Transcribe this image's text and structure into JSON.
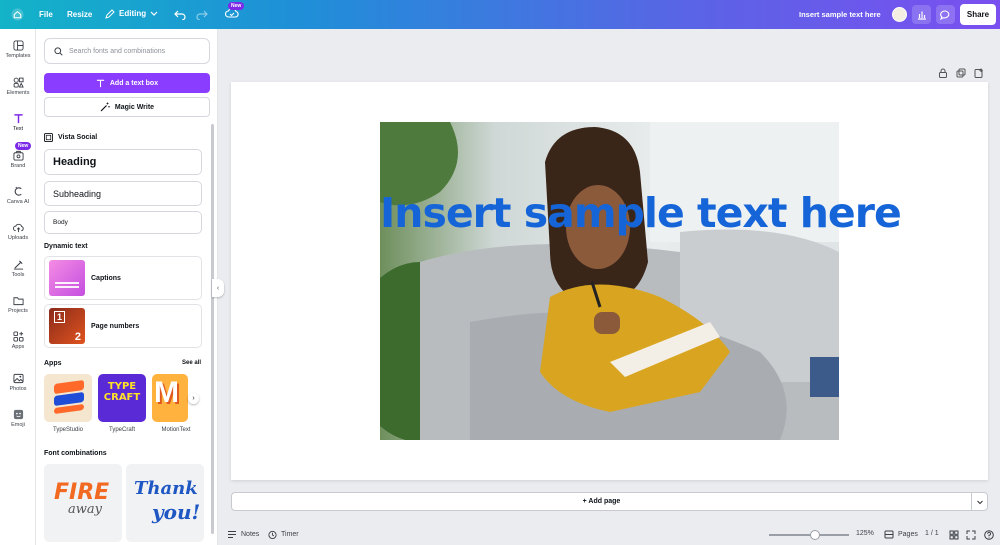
{
  "topbar": {
    "file": "File",
    "resize": "Resize",
    "editing": "Editing",
    "new_badge": "New",
    "doc_title": "Insert sample text here",
    "share": "Share"
  },
  "rail": {
    "items": [
      {
        "label": "Templates",
        "icon": "templates-icon"
      },
      {
        "label": "Elements",
        "icon": "elements-icon"
      },
      {
        "label": "Text",
        "icon": "text-icon"
      },
      {
        "label": "Brand",
        "icon": "brand-icon"
      },
      {
        "label": "Canva AI",
        "icon": "canva-ai-icon"
      },
      {
        "label": "Uploads",
        "icon": "uploads-icon"
      },
      {
        "label": "Tools",
        "icon": "tools-icon"
      },
      {
        "label": "Projects",
        "icon": "projects-icon"
      },
      {
        "label": "Apps",
        "icon": "apps-icon"
      },
      {
        "label": "Photos",
        "icon": "photos-icon"
      },
      {
        "label": "Emoji",
        "icon": "emoji-icon"
      }
    ],
    "brand_badge": "New"
  },
  "panel": {
    "search_placeholder": "Search fonts and combinations",
    "add_text_box": "Add a text box",
    "magic_write": "Magic Write",
    "brand_kit": "Vista Social",
    "heading": "Heading",
    "subheading": "Subheading",
    "body": "Body",
    "dynamic_text_title": "Dynamic text",
    "captions": "Captions",
    "page_numbers": "Page numbers",
    "page_numbers_thumb_1": "1",
    "page_numbers_thumb_2": "2",
    "apps_title": "Apps",
    "see_all": "See all",
    "apps": [
      "TypeStudio",
      "TypeCraft",
      "MotionText"
    ],
    "typecraft_logo": "TYPE CRAFT",
    "font_combinations_title": "Font combinations",
    "font_combo_1_line1": "FIRE",
    "font_combo_1_line2": "away",
    "font_combo_2_line1": "Thank",
    "font_combo_2_line2": "you!"
  },
  "canvas": {
    "text": "Insert sample text here",
    "add_page": "+ Add page",
    "accent": "#1565d8"
  },
  "bottombar": {
    "notes": "Notes",
    "timer": "Timer",
    "zoom": "125%",
    "zoom_fraction": 0.58,
    "pages": "Pages",
    "page_count": "1 / 1"
  }
}
